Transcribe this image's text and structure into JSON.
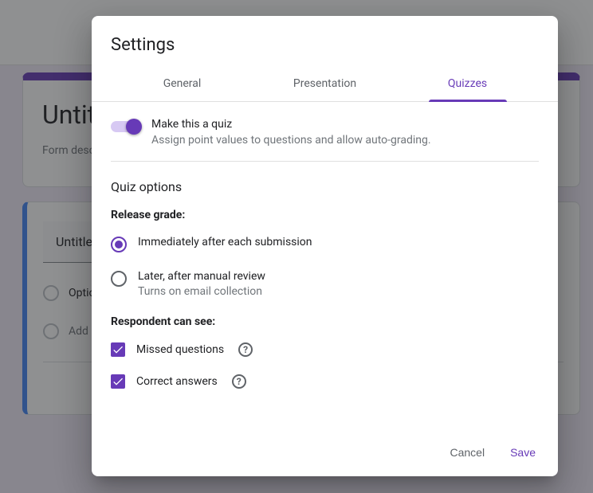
{
  "background": {
    "form_title": "Untitled",
    "form_desc": "Form desc",
    "question": "Untitle",
    "option1": "Optio",
    "add_option": "Add o"
  },
  "dialog": {
    "title": "Settings",
    "tabs": {
      "general": "General",
      "presentation": "Presentation",
      "quizzes": "Quizzes"
    },
    "make_quiz": {
      "title": "Make this a quiz",
      "subtitle": "Assign point values to questions and allow auto-grading."
    },
    "quiz_options_header": "Quiz options",
    "release_grade": {
      "label": "Release grade:",
      "immediate": "Immediately after each submission",
      "later": "Later, after manual review",
      "later_sub": "Turns on email collection"
    },
    "respondent": {
      "label": "Respondent can see:",
      "missed": "Missed questions",
      "correct": "Correct answers"
    },
    "actions": {
      "cancel": "Cancel",
      "save": "Save"
    }
  }
}
